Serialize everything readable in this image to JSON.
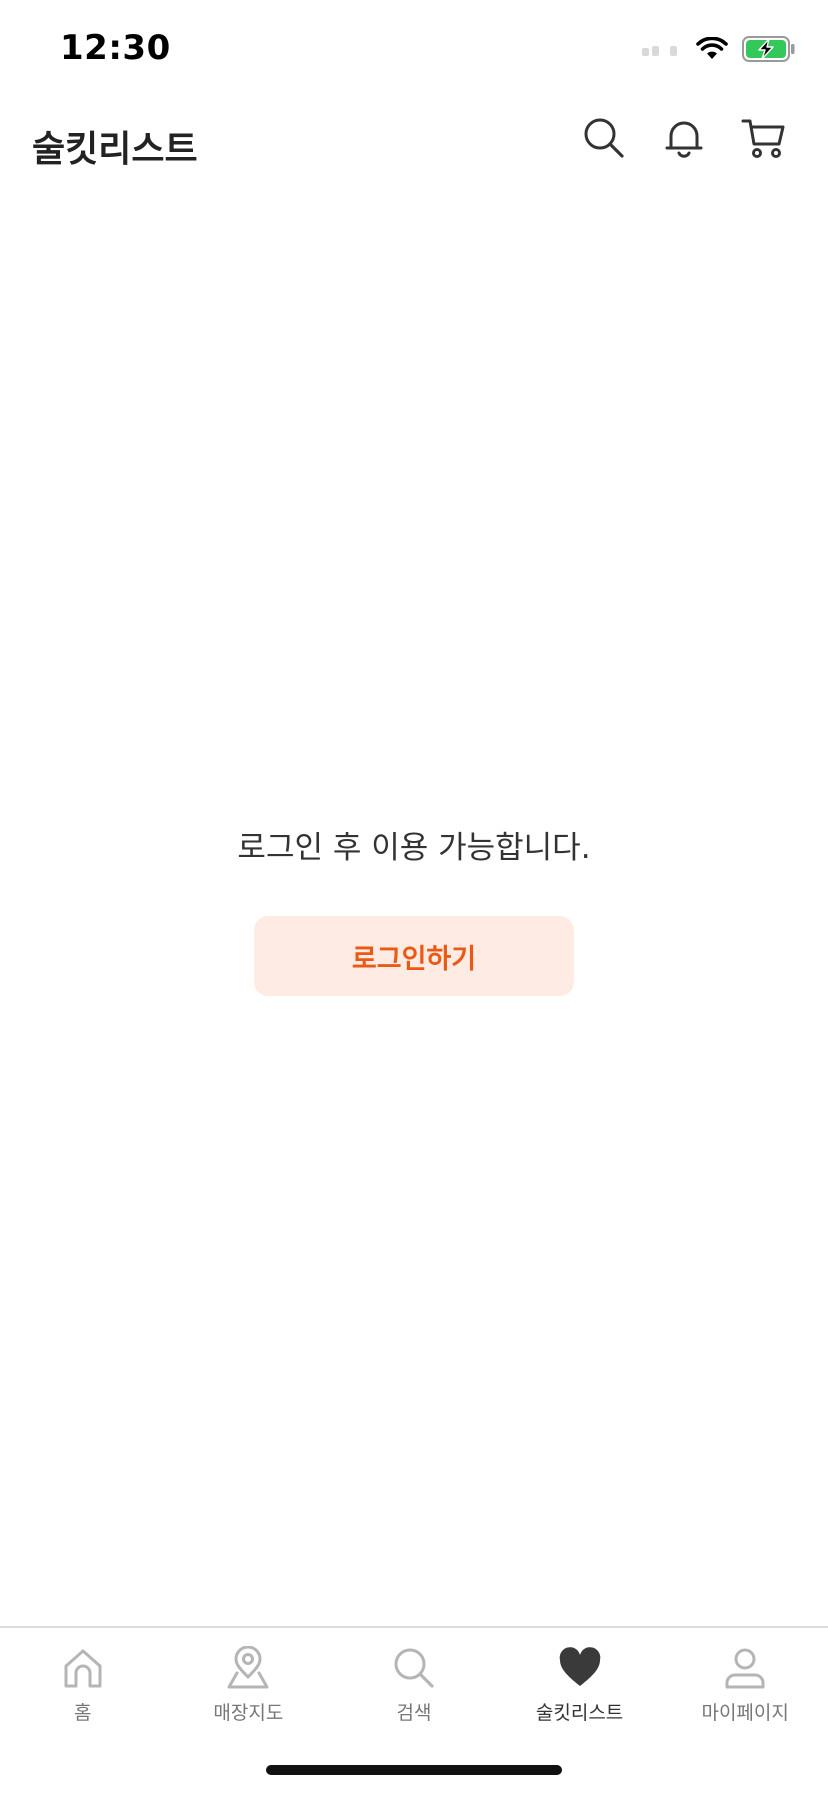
{
  "status_bar": {
    "time": "12:30"
  },
  "header": {
    "title": "술킷리스트",
    "actions": [
      {
        "icon": "search-icon"
      },
      {
        "icon": "bell-icon"
      },
      {
        "icon": "cart-icon"
      }
    ]
  },
  "main": {
    "message": "로그인 후 이용 가능합니다.",
    "login_button_label": "로그인하기"
  },
  "tabs": [
    {
      "label": "홈",
      "icon": "home-icon",
      "active": false
    },
    {
      "label": "매장지도",
      "icon": "map-pin-icon",
      "active": false
    },
    {
      "label": "검색",
      "icon": "search-icon",
      "active": false
    },
    {
      "label": "술킷리스트",
      "icon": "heart-icon",
      "active": true
    },
    {
      "label": "마이페이지",
      "icon": "user-icon",
      "active": false
    }
  ],
  "colors": {
    "accent": "#ea5a16",
    "accent_bg": "#fdebe4",
    "battery": "#34c759",
    "icon_inactive": "#b5b5b5",
    "icon_active": "#3a3a3a"
  }
}
